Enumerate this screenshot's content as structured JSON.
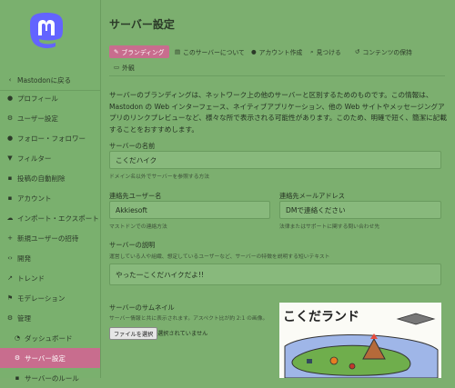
{
  "sidebar": {
    "items": [
      {
        "icon": "chevron-left-icon",
        "glyph": "‹",
        "label": "Mastodonに戻る"
      },
      {
        "icon": "user-icon",
        "glyph": "●",
        "label": "プロフィール"
      },
      {
        "icon": "gear-icon",
        "glyph": "⚙",
        "label": "ユーザー設定"
      },
      {
        "icon": "users-icon",
        "glyph": "●",
        "label": "フォロー・フォロワー"
      },
      {
        "icon": "filter-icon",
        "glyph": "▼",
        "label": "フィルター"
      },
      {
        "icon": "trash-icon",
        "glyph": "▪",
        "label": "投稿の自動削除"
      },
      {
        "icon": "lock-icon",
        "glyph": "▪",
        "label": "アカウント"
      },
      {
        "icon": "cloud-icon",
        "glyph": "☁",
        "label": "インポート・エクスポート"
      },
      {
        "icon": "user-plus-icon",
        "glyph": "+",
        "label": "新規ユーザーの招待"
      },
      {
        "icon": "code-icon",
        "glyph": "‹›",
        "label": "開発"
      },
      {
        "icon": "trend-icon",
        "glyph": "↗",
        "label": "トレンド"
      },
      {
        "icon": "flag-icon",
        "glyph": "⚑",
        "label": "モデレーション"
      },
      {
        "icon": "cogs-icon",
        "glyph": "⚙",
        "label": "管理"
      },
      {
        "icon": "dashboard-icon",
        "glyph": "◔",
        "label": "ダッシュボード"
      },
      {
        "icon": "gear-icon",
        "glyph": "⚙",
        "label": "サーバー設定"
      },
      {
        "icon": "server-rules-icon",
        "glyph": "▪",
        "label": "サーバーのルール"
      }
    ]
  },
  "main": {
    "title": "サーバー設定",
    "tabs": [
      {
        "icon": "pencil-icon",
        "glyph": "✎",
        "label": "ブランディング"
      },
      {
        "icon": "file-icon",
        "glyph": "▤",
        "label": "このサーバーについて"
      },
      {
        "icon": "users-icon",
        "glyph": "●",
        "label": "アカウント作成"
      },
      {
        "icon": "search-icon",
        "glyph": "⌕",
        "label": "見つける"
      },
      {
        "icon": "history-icon",
        "glyph": "↺",
        "label": "コンテンツの保持"
      },
      {
        "icon": "desktop-icon",
        "glyph": "▭",
        "label": "外観"
      }
    ],
    "intro": "サーバーのブランディングは、ネットワーク上の他のサーバーと区別するためのものです。この情報は、Mastodon の Web インターフェース、ネイティブアプリケーション、他の Web サイトやメッセージングアプリのリンクプレビューなど、様々な所で表示される可能性があります。このため、明確で短く、簡潔に記載することをおすすめします。",
    "server_name": {
      "label": "サーバーの名前",
      "value": "こくだハイク",
      "hint": "ドメイン名以外でサーバーを参照する方法"
    },
    "contact_user": {
      "label": "連絡先ユーザー名",
      "value": "Akkiesoft",
      "hint": "マストドンでの連絡方法"
    },
    "contact_email": {
      "label": "連絡先メールアドレス",
      "value": "DMで連絡ください",
      "hint": "法律またはサポートに関する問い合わせ先"
    },
    "description": {
      "label": "サーバーの説明",
      "hint": "運営している人や組織、想定しているユーザーなど、サーバーの特徴を説明する短いテキスト",
      "value": "やった一こくだハイクだよ!!"
    },
    "thumbnail": {
      "label": "サーバーのサムネイル",
      "hint": "サーバー情報と共に表示されます。アスペクト比が約 2:1 の画像。",
      "button": "ファイルを選択",
      "status": "選択されていません",
      "image_text": "こくだランド"
    }
  },
  "colors": {
    "background": "#7caf6f",
    "accent": "#c86d8e",
    "logo": "#6364ff"
  }
}
